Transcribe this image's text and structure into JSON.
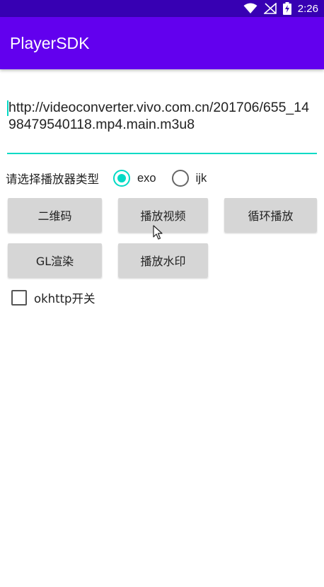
{
  "status_bar": {
    "time": "2:26"
  },
  "app_bar": {
    "title": "PlayerSDK"
  },
  "url_input": {
    "value": "http://videoconverter.vivo.com.cn/201706/655_1498479540118.mp4.main.m3u8"
  },
  "player_type": {
    "label": "请选择播放器类型",
    "options": [
      {
        "label": "exo",
        "checked": true
      },
      {
        "label": "ijk",
        "checked": false
      }
    ]
  },
  "buttons": {
    "qrcode": "二维码",
    "play_video": "播放视频",
    "loop_play": "循环播放",
    "gl_render": "GL渲染",
    "play_watermark": "播放水印"
  },
  "okhttp": {
    "label": "okhttp开关",
    "checked": false
  },
  "colors": {
    "accent": "#03dac5",
    "app_bar": "#6200ee",
    "status_bar": "#3700b3"
  }
}
